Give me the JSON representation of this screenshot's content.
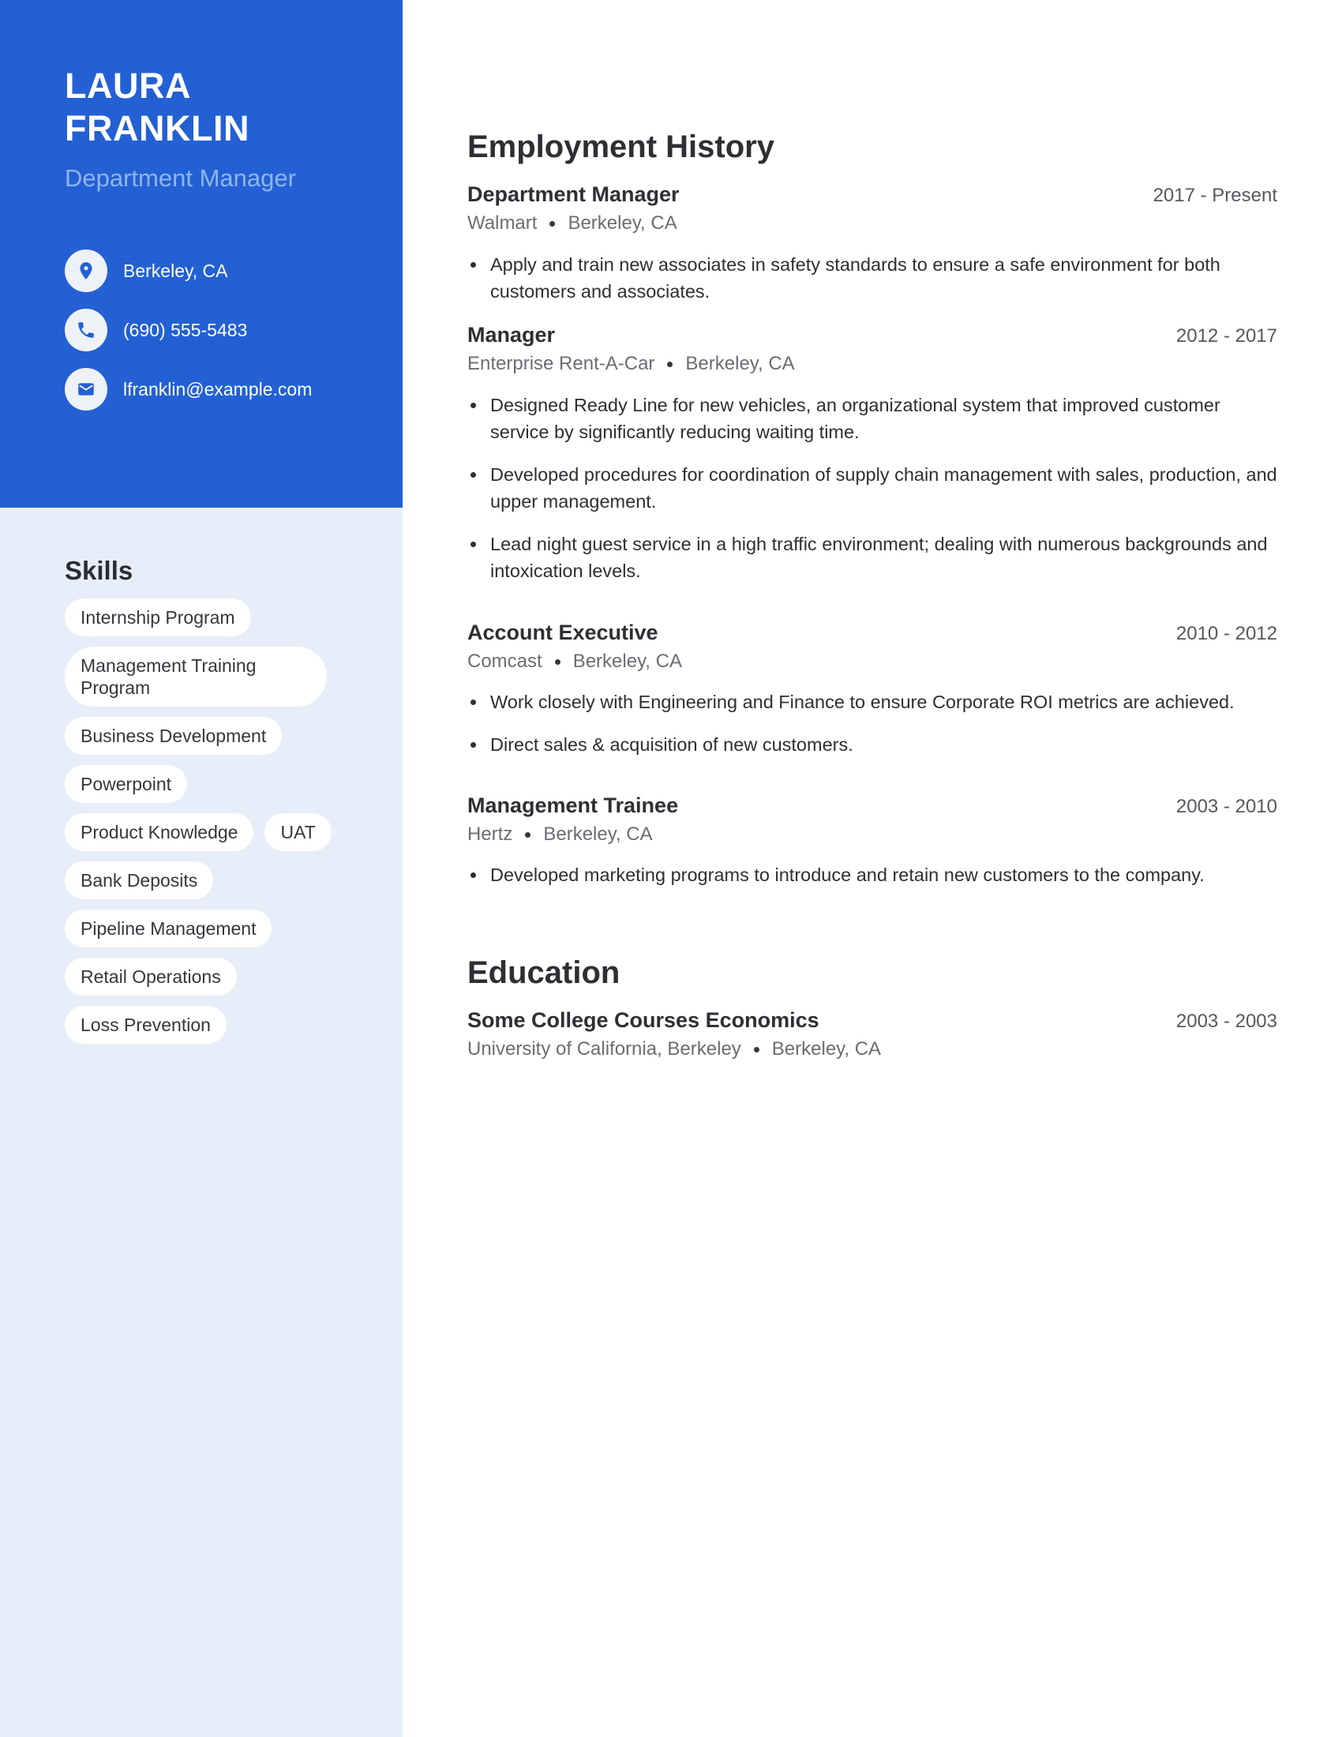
{
  "profile": {
    "first_name": "LAURA",
    "last_name": "FRANKLIN",
    "title": "Department Manager"
  },
  "contact": {
    "location": "Berkeley, CA",
    "phone": "(690) 555-5483",
    "email": "lfranklin@example.com",
    "icons": [
      "location-pin-icon",
      "phone-icon",
      "email-icon"
    ]
  },
  "skills": {
    "heading": "Skills",
    "items": [
      "Internship Program",
      "Management Training Program",
      "Business Development",
      "Powerpoint",
      "Product Knowledge",
      "UAT",
      "Bank Deposits",
      "Pipeline Management",
      "Retail Operations",
      "Loss Prevention"
    ]
  },
  "employment": {
    "heading": "Employment History",
    "jobs": [
      {
        "role": "Department Manager",
        "dates": "2017 - Present",
        "company": "Walmart",
        "location": "Berkeley, CA",
        "bullets": [
          "Apply and train new associates in safety standards to ensure a safe environment for both customers and associates."
        ]
      },
      {
        "role": "Manager",
        "dates": "2012 - 2017",
        "company": "Enterprise Rent-A-Car",
        "location": "Berkeley, CA",
        "bullets": [
          "Designed Ready Line for new vehicles, an organizational system that improved customer service by significantly reducing waiting time.",
          "Developed procedures for coordination of supply chain management with sales, production, and upper management.",
          "Lead night guest service in a high traffic environment; dealing with numerous backgrounds and intoxication levels."
        ]
      },
      {
        "role": "Account Executive",
        "dates": "2010 - 2012",
        "company": "Comcast",
        "location": "Berkeley, CA",
        "bullets": [
          "Work closely with Engineering and Finance to ensure Corporate ROI metrics are achieved.",
          "Direct sales & acquisition of new customers."
        ]
      },
      {
        "role": "Management Trainee",
        "dates": "2003 - 2010",
        "company": "Hertz",
        "location": "Berkeley, CA",
        "bullets": [
          "Developed marketing programs to introduce and retain new customers to the company."
        ]
      }
    ]
  },
  "education": {
    "heading": "Education",
    "items": [
      {
        "degree": "Some College Courses Economics",
        "dates": "2003 - 2003",
        "school": "University of California, Berkeley",
        "location": "Berkeley, CA"
      }
    ]
  },
  "colors": {
    "accent": "#2360d3",
    "sidebar_light": "#e7eef9",
    "subtitle": "#8fb4f0",
    "text": "#2d2f33",
    "muted": "#6a6d72"
  }
}
